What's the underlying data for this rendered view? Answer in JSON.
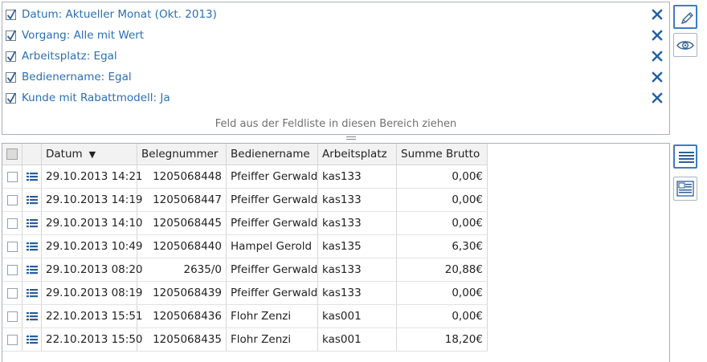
{
  "filters": [
    {
      "label": "Datum: Aktueller Monat   (Okt. 2013)",
      "checked": true
    },
    {
      "label": "Vorgang: Alle mit Wert",
      "checked": true
    },
    {
      "label": "Arbeitsplatz: Egal",
      "checked": true
    },
    {
      "label": "Bedienername: Egal",
      "checked": true
    },
    {
      "label": "Kunde mit Rabattmodell: Ja",
      "checked": true
    }
  ],
  "drop_hint": "Feld aus der Feldliste in diesen Bereich ziehen",
  "side_toolbar": {
    "top": [
      "pencil-icon",
      "eye-icon"
    ],
    "bottom": [
      "list-view-icon",
      "card-view-icon"
    ]
  },
  "table": {
    "columns": [
      "Datum",
      "Belegnummer",
      "Bedienername",
      "Arbeitsplatz",
      "Summe Brutto"
    ],
    "sort_column": "Datum",
    "sort_direction": "descending",
    "rows": [
      {
        "datum": "29.10.2013 14:21",
        "beleg": "1205068448",
        "bediener": "Pfeiffer Gerwald",
        "platz": "kas133",
        "summe": "0,00€"
      },
      {
        "datum": "29.10.2013 14:19",
        "beleg": "1205068447",
        "bediener": "Pfeiffer Gerwald",
        "platz": "kas133",
        "summe": "0,00€"
      },
      {
        "datum": "29.10.2013 14:10",
        "beleg": "1205068445",
        "bediener": "Pfeiffer Gerwald",
        "platz": "kas133",
        "summe": "0,00€"
      },
      {
        "datum": "29.10.2013 10:49",
        "beleg": "1205068440",
        "bediener": "Hampel Gerold",
        "platz": "kas135",
        "summe": "6,30€"
      },
      {
        "datum": "29.10.2013 08:20",
        "beleg": "2635/0",
        "bediener": "Pfeiffer Gerwald",
        "platz": "kas133",
        "summe": "20,88€"
      },
      {
        "datum": "29.10.2013 08:19",
        "beleg": "1205068439",
        "bediener": "Pfeiffer Gerwald",
        "platz": "kas133",
        "summe": "0,00€"
      },
      {
        "datum": "22.10.2013 15:51",
        "beleg": "1205068436",
        "bediener": "Flohr Zenzi",
        "platz": "kas001",
        "summe": "0,00€"
      },
      {
        "datum": "22.10.2013 15:50",
        "beleg": "1205068435",
        "bediener": "Flohr Zenzi",
        "platz": "kas001",
        "summe": "18,20€"
      }
    ]
  },
  "colors": {
    "accent": "#2a6fb5",
    "remove": "#1f5fa8",
    "border": "#aab0b8"
  }
}
